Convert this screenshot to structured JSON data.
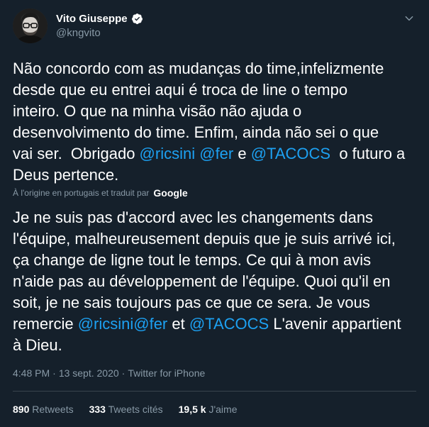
{
  "author": {
    "display_name": "Vito Giuseppe",
    "handle": "@kngvito",
    "verified_icon": "verified-badge-icon",
    "menu_icon": "chevron-down-icon"
  },
  "original": {
    "line1": "Não concordo com as mudanças do time,infelizmente",
    "line2": "desde que eu entrei aqui é troca de line o tempo",
    "line3": "inteiro. O que na minha visão não ajuda o",
    "line4": "desenvolvimento do time. Enfim, ainda não sei o que",
    "line5_start": "vai ser.  Obrigado ",
    "mention1": "@ricsini",
    "space1": " ",
    "mention2": "@fer",
    "and_word": " e ",
    "mention3": "@TACOCS",
    "line5_end": "  o futuro a",
    "line6": "Deus pertence."
  },
  "translation_note": {
    "text": "À l'origine en portugais et traduit par",
    "provider": "Google"
  },
  "translated": {
    "line1": "Je ne suis pas d'accord avec les changements dans",
    "line2": "l'équipe, malheureusement depuis que je suis arrivé ici,",
    "line3": "ça change de ligne tout le temps. Ce qui à mon avis",
    "line4": "n'aide pas au développement de l'équipe. Quoi qu'il en",
    "line5": "soit, je ne sais toujours pas ce que ce sera. Je vous",
    "line6_start": "remercie ",
    "mention1": "@ricsini",
    "mention2": "@fer",
    "and_word": " et ",
    "mention3": "@TACOCS",
    "line6_end": " L'avenir appartient",
    "line7": "à Dieu."
  },
  "meta": {
    "time": "4:48 PM",
    "sep1": "·",
    "date": "13 sept. 2020",
    "sep2": "·",
    "source": "Twitter for iPhone"
  },
  "stats": {
    "retweets_count": "890",
    "retweets_label": "Retweets",
    "quotes_count": "333",
    "quotes_label": "Tweets cités",
    "likes_count": "19,5 k",
    "likes_label": "J'aime"
  },
  "colors": {
    "background": "#15202b",
    "mention": "#1da1f2",
    "secondary_text": "#8899a6",
    "verified": "#ffffff"
  }
}
